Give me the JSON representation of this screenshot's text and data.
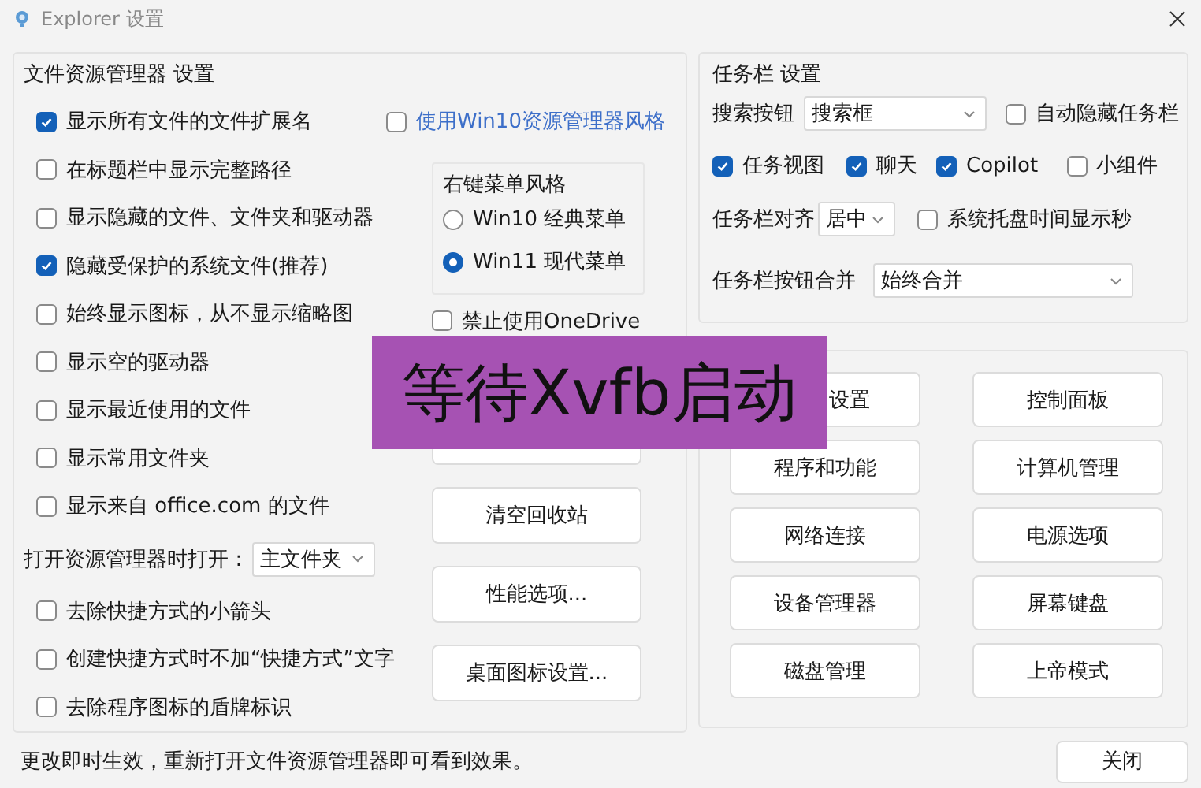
{
  "window": {
    "title": "Explorer 设置"
  },
  "explorer_settings": {
    "title": "文件资源管理器 设置",
    "options": [
      {
        "label": "显示所有文件的文件扩展名",
        "checked": true
      },
      {
        "label": "在标题栏中显示完整路径",
        "checked": false
      },
      {
        "label": "显示隐藏的文件、文件夹和驱动器",
        "checked": false
      },
      {
        "label": "隐藏受保护的系统文件(推荐)",
        "checked": true
      },
      {
        "label": "始终显示图标，从不显示缩略图",
        "checked": false
      },
      {
        "label": "显示空的驱动器",
        "checked": false
      },
      {
        "label": "显示最近使用的文件",
        "checked": false
      },
      {
        "label": "显示常用文件夹",
        "checked": false
      },
      {
        "label": "显示来自 office.com 的文件",
        "checked": false
      }
    ],
    "open_in": {
      "label": "打开资源管理器时打开：",
      "value": "主文件夹"
    },
    "options_2": [
      {
        "label": "去除快捷方式的小箭头",
        "checked": false
      },
      {
        "label": "创建快捷方式时不加“快捷方式”文字",
        "checked": false
      },
      {
        "label": "去除程序图标的盾牌标识",
        "checked": false
      }
    ],
    "win10_style": {
      "label": "使用Win10资源管理器风格",
      "checked": false
    },
    "context_menu": {
      "title": "右键菜单风格",
      "options": [
        {
          "label": "Win10 经典菜单",
          "selected": false
        },
        {
          "label": "Win11 现代菜单",
          "selected": true
        }
      ]
    },
    "disable_onedrive": {
      "label": "禁止使用OneDrive",
      "checked": false
    },
    "buttons": [
      {
        "kind": "covered"
      },
      {
        "label": "清空回收站"
      },
      {
        "label": "性能选项..."
      },
      {
        "label": "桌面图标设置..."
      }
    ]
  },
  "taskbar_settings": {
    "title": "任务栏 设置",
    "search_button": {
      "label": "搜索按钮",
      "value": "搜索框"
    },
    "auto_hide": {
      "label": "自动隐藏任务栏",
      "checked": false
    },
    "toggles": [
      {
        "label": "任务视图",
        "checked": true
      },
      {
        "label": "聊天",
        "checked": true
      },
      {
        "label": "Copilot",
        "checked": true
      },
      {
        "label": "小组件",
        "checked": false
      }
    ],
    "alignment": {
      "label": "任务栏对齐",
      "value": "居中"
    },
    "tray_seconds": {
      "label": "系统托盘时间显示秒",
      "checked": false
    },
    "combine": {
      "label": "任务栏按钮合并",
      "value": "始终合并"
    }
  },
  "tools": [
    {
      "label": "设置",
      "kind": "partial"
    },
    {
      "label": "控制面板"
    },
    {
      "label": "程序和功能"
    },
    {
      "label": "计算机管理"
    },
    {
      "label": "网络连接"
    },
    {
      "label": "电源选项"
    },
    {
      "label": "设备管理器"
    },
    {
      "label": "屏幕键盘"
    },
    {
      "label": "磁盘管理"
    },
    {
      "label": "上帝模式"
    }
  ],
  "footer": {
    "message": "更改即时生效，重新打开文件资源管理器即可看到效果。",
    "close_button": "关闭"
  },
  "overlay": {
    "text": "等待Xvfb启动"
  }
}
